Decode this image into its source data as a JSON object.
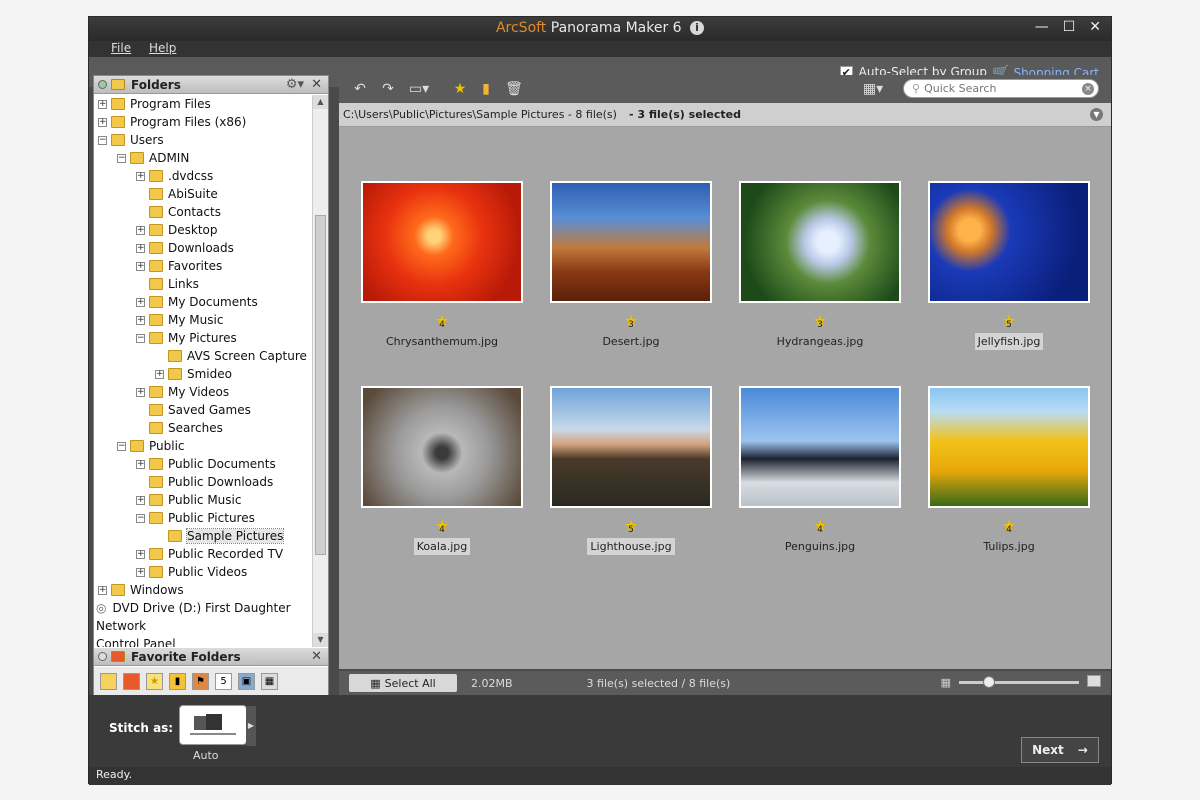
{
  "app": {
    "brand": "ArcSoft",
    "title": "Panorama Maker 6",
    "info_icon": "i",
    "window": {
      "minimize": "—",
      "maximize": "☐",
      "close": "✕"
    }
  },
  "menu": {
    "file": "File",
    "help": "Help"
  },
  "header": {
    "auto_select": "Auto-Select by Group",
    "auto_select_checked": true,
    "shopping_cart": "Shopping Cart"
  },
  "folders": {
    "title": "Folders",
    "favorite_title": "Favorite Folders",
    "tree": [
      {
        "label": "Program Files",
        "level": 0,
        "exp": "+"
      },
      {
        "label": "Program Files (x86)",
        "level": 0,
        "exp": "+"
      },
      {
        "label": "Users",
        "level": 0,
        "exp": "−"
      },
      {
        "label": "ADMIN",
        "level": 1,
        "exp": "−"
      },
      {
        "label": ".dvdcss",
        "level": 2,
        "exp": "+"
      },
      {
        "label": "AbiSuite",
        "level": 2,
        "exp": ""
      },
      {
        "label": "Contacts",
        "level": 2,
        "exp": ""
      },
      {
        "label": "Desktop",
        "level": 2,
        "exp": "+"
      },
      {
        "label": "Downloads",
        "level": 2,
        "exp": "+"
      },
      {
        "label": "Favorites",
        "level": 2,
        "exp": "+"
      },
      {
        "label": "Links",
        "level": 2,
        "exp": ""
      },
      {
        "label": "My Documents",
        "level": 2,
        "exp": "+"
      },
      {
        "label": "My Music",
        "level": 2,
        "exp": "+"
      },
      {
        "label": "My Pictures",
        "level": 2,
        "exp": "−"
      },
      {
        "label": "AVS Screen Capture",
        "level": 3,
        "exp": ""
      },
      {
        "label": "Smideo",
        "level": 3,
        "exp": "+"
      },
      {
        "label": "My Videos",
        "level": 2,
        "exp": "+"
      },
      {
        "label": "Saved Games",
        "level": 2,
        "exp": ""
      },
      {
        "label": "Searches",
        "level": 2,
        "exp": ""
      },
      {
        "label": "Public",
        "level": 1,
        "exp": "−"
      },
      {
        "label": "Public Documents",
        "level": 2,
        "exp": "+"
      },
      {
        "label": "Public Downloads",
        "level": 2,
        "exp": ""
      },
      {
        "label": "Public Music",
        "level": 2,
        "exp": "+"
      },
      {
        "label": "Public Pictures",
        "level": 2,
        "exp": "−"
      },
      {
        "label": "Sample Pictures",
        "level": 3,
        "exp": "",
        "selected": true
      },
      {
        "label": "Public Recorded TV",
        "level": 2,
        "exp": "+"
      },
      {
        "label": "Public Videos",
        "level": 2,
        "exp": "+"
      },
      {
        "label": "Windows",
        "level": 0,
        "exp": "+"
      },
      {
        "label": "DVD Drive (D:) First Daughter",
        "level": -1,
        "exp": ""
      },
      {
        "label": "Network",
        "level": -2,
        "exp": ""
      },
      {
        "label": "Control Panel",
        "level": -2,
        "exp": ""
      }
    ]
  },
  "toolbar": {
    "search_placeholder": "Quick Search"
  },
  "path": {
    "location": "C:\\Users\\Public\\Pictures\\Sample Pictures - 8 file(s)",
    "selection": "- 3 file(s) selected"
  },
  "photos": [
    {
      "name": "Chrysanthemum.jpg",
      "rating": "4",
      "selected": false,
      "bg": "radial-gradient(circle at 45% 45%, #ffd27a 0 6%, #ff6a1a 18%, #e8320f 45%, #b81a08 80%)"
    },
    {
      "name": "Desert.jpg",
      "rating": "3",
      "selected": false,
      "bg": "linear-gradient(#2f5fb3 0%, #5a8ed6 30%, #c07a3a 55%, #8a3a14 75%, #5a200a 100%)"
    },
    {
      "name": "Hydrangeas.jpg",
      "rating": "3",
      "selected": false,
      "bg": "radial-gradient(circle at 55% 50%, #e6f0ff 0 10%, #b9c8e6 22%, #5b8a3a 40%, #1e4a1a 80%)"
    },
    {
      "name": "Jellyfish.jpg",
      "rating": "5",
      "selected": true,
      "bg": "radial-gradient(circle at 25% 40%, #ffb14a 0 8%, #d0782a 16%, #1a3ab8 30%, #0a1f7a 80%)"
    },
    {
      "name": "Koala.jpg",
      "rating": "4",
      "selected": true,
      "bg": "radial-gradient(circle at 50% 55%, #3a3a3a 0 6%, #b8b8b8 20%, #9a9a9a 45%, #5a4a3a 90%)"
    },
    {
      "name": "Lighthouse.jpg",
      "rating": "5",
      "selected": true,
      "bg": "linear-gradient(#6fa3d8 0%, #c7d9ea 35%, #d3a07a 48%, #4a3a2a 60%, #2a2a22 100%)"
    },
    {
      "name": "Penguins.jpg",
      "rating": "4",
      "selected": false,
      "bg": "linear-gradient(#4a8ad8 0%, #9cc4ef 45%, #1c2230 60%, #d8dde2 80%, #b9c0c8 100%)"
    },
    {
      "name": "Tulips.jpg",
      "rating": "4",
      "selected": false,
      "bg": "linear-gradient(#8ac4f0 0%, #b8dcf5 20%, #f2c21a 45%, #e8a80a 70%, #3a6a1a 100%)"
    }
  ],
  "status": {
    "select_all": "Select All",
    "size": "2.02MB",
    "count": "3 file(s) selected / 8 file(s)"
  },
  "stitch": {
    "label": "Stitch as:",
    "option": "Auto"
  },
  "next": "Next",
  "ready": "Ready."
}
